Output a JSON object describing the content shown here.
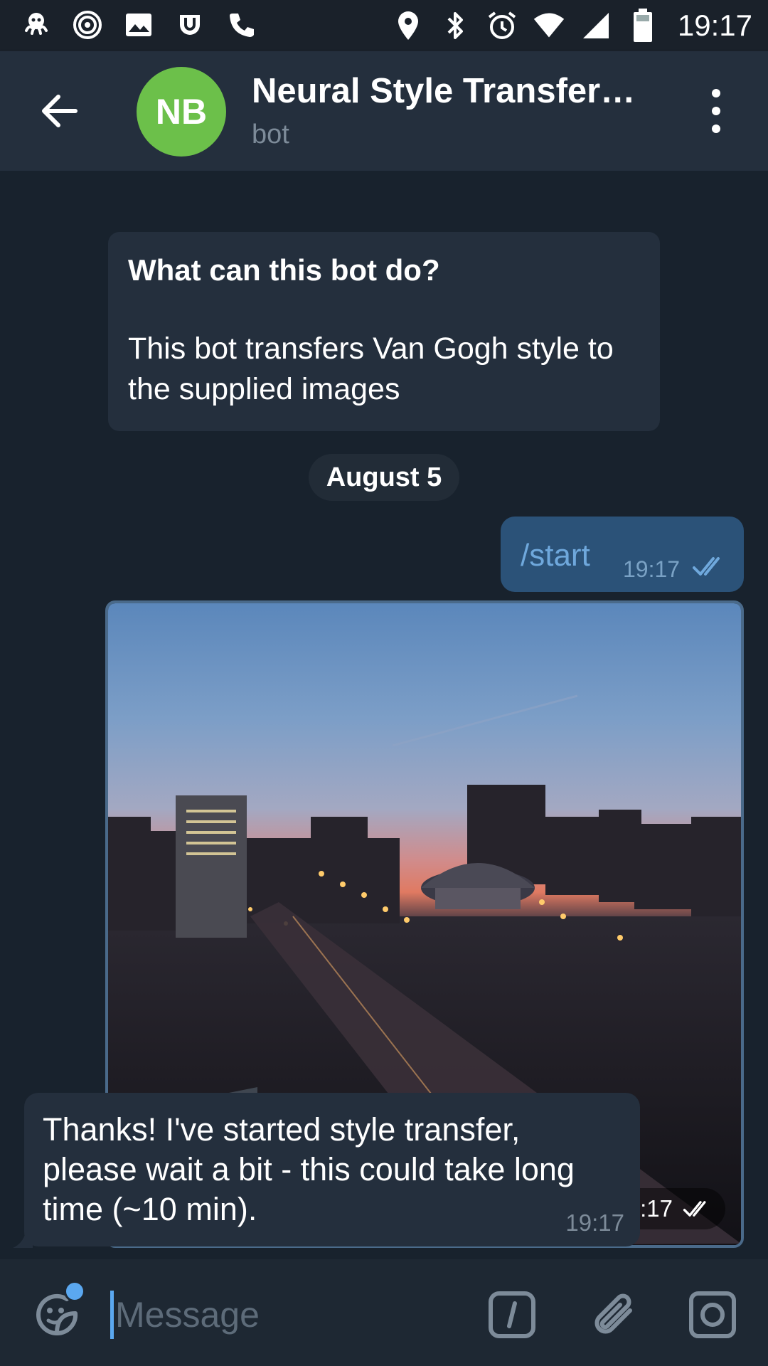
{
  "status_bar": {
    "time": "19:17",
    "left_icons": [
      "octopus-icon",
      "signal-rings-icon",
      "image-icon",
      "cup-icon",
      "phone-icon"
    ],
    "right_icons": [
      "location-icon",
      "bluetooth-icon",
      "alarm-icon",
      "wifi-icon",
      "cell-signal-icon",
      "battery-icon"
    ]
  },
  "header": {
    "avatar_initials": "NB",
    "avatar_color": "#6cc04a",
    "title": "Neural Style Transfer…",
    "subtitle": "bot"
  },
  "chat": {
    "intro": {
      "title": "What can this bot do?",
      "text": "This bot transfers Van Gogh style to the supplied images"
    },
    "date_separator": "August 5",
    "messages": [
      {
        "type": "outgoing_text",
        "text": "/start",
        "time": "19:17",
        "status": "read"
      },
      {
        "type": "outgoing_photo",
        "time": "19:17",
        "status": "read",
        "description": "city-sunset-photo"
      },
      {
        "type": "incoming_text",
        "text": "Thanks! I've started style transfer, please wait a bit - this could take long time (~10 min).",
        "time": "19:17"
      }
    ]
  },
  "input_bar": {
    "placeholder": "Message",
    "value": ""
  },
  "colors": {
    "accent": "#5ba8f0",
    "outgoing_bubble": "#2b5278",
    "incoming_bubble": "#242f3d",
    "background": "#18222d"
  }
}
